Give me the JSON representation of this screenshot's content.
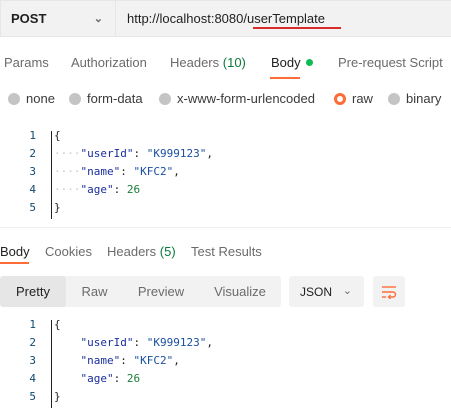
{
  "request": {
    "method": "POST",
    "url": "http://localhost:8080/userTemplate"
  },
  "request_tabs": [
    {
      "label": "Params"
    },
    {
      "label": "Authorization"
    },
    {
      "label": "Headers",
      "count": "(10)"
    },
    {
      "label": "Body",
      "active": true
    },
    {
      "label": "Pre-request Script"
    }
  ],
  "body_types": [
    {
      "label": "none"
    },
    {
      "label": "form-data"
    },
    {
      "label": "x-www-form-urlencoded"
    },
    {
      "label": "raw",
      "selected": true
    },
    {
      "label": "binary"
    }
  ],
  "request_body_lines": [
    {
      "n": "1",
      "text": "{"
    },
    {
      "n": "2",
      "key": "\"userId\"",
      "value": "\"K999123\"",
      "sep": ","
    },
    {
      "n": "3",
      "key": "\"name\"",
      "value": "\"KFC2\"",
      "sep": ","
    },
    {
      "n": "4",
      "key": "\"age\"",
      "value": "26",
      "sep": ""
    },
    {
      "n": "5",
      "text": "}"
    }
  ],
  "response_tabs": [
    {
      "label": "Body",
      "active": true
    },
    {
      "label": "Cookies"
    },
    {
      "label": "Headers",
      "count": "(5)"
    },
    {
      "label": "Test Results"
    }
  ],
  "view_modes": [
    {
      "label": "Pretty",
      "active": true
    },
    {
      "label": "Raw"
    },
    {
      "label": "Preview"
    },
    {
      "label": "Visualize"
    }
  ],
  "format_select": {
    "value": "JSON"
  },
  "response_body_lines": [
    {
      "n": "1",
      "text": "{"
    },
    {
      "n": "2",
      "key": "\"userId\"",
      "value": "\"K999123\"",
      "sep": ","
    },
    {
      "n": "3",
      "key": "\"name\"",
      "value": "\"KFC2\"",
      "sep": ","
    },
    {
      "n": "4",
      "key": "\"age\"",
      "value": "26",
      "sep": ""
    },
    {
      "n": "5",
      "text": "}"
    }
  ],
  "colors": {
    "accent": "#ff6c37",
    "status_green": "#0cbb52",
    "url_highlight": "#d92d2d"
  },
  "icons": [
    "chevron-down-icon",
    "green-dot-icon",
    "wrap-lines-icon"
  ]
}
